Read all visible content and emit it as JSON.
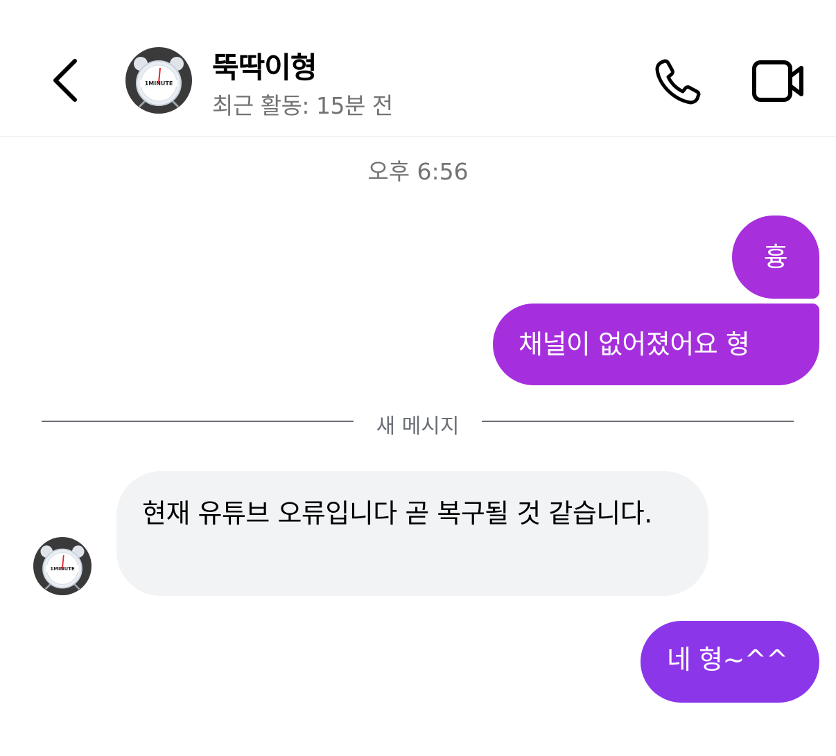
{
  "header": {
    "contact_name": "뚝딱이형",
    "status": "최근 활동: 15분 전",
    "avatar_label": "1MINUTE"
  },
  "conversation": {
    "timestamp": "오후 6:56",
    "new_messages_divider": "새 메시지",
    "messages": [
      {
        "direction": "outgoing",
        "text": "흉"
      },
      {
        "direction": "outgoing",
        "text": "채널이 없어졌어요 형"
      },
      {
        "direction": "incoming",
        "text": "현재 유튜브 오류입니다 곧 복구될 것 같습니다."
      },
      {
        "direction": "outgoing",
        "text": "네 형~^^"
      }
    ]
  },
  "icons": {
    "back": "chevron-left-icon",
    "call": "phone-icon",
    "video": "video-camera-icon"
  },
  "colors": {
    "outgoing_bubble": "#a62fdd",
    "outgoing_bubble_last": "#8c36ea",
    "incoming_bubble": "#f2f3f5",
    "secondary_text": "#737373"
  }
}
